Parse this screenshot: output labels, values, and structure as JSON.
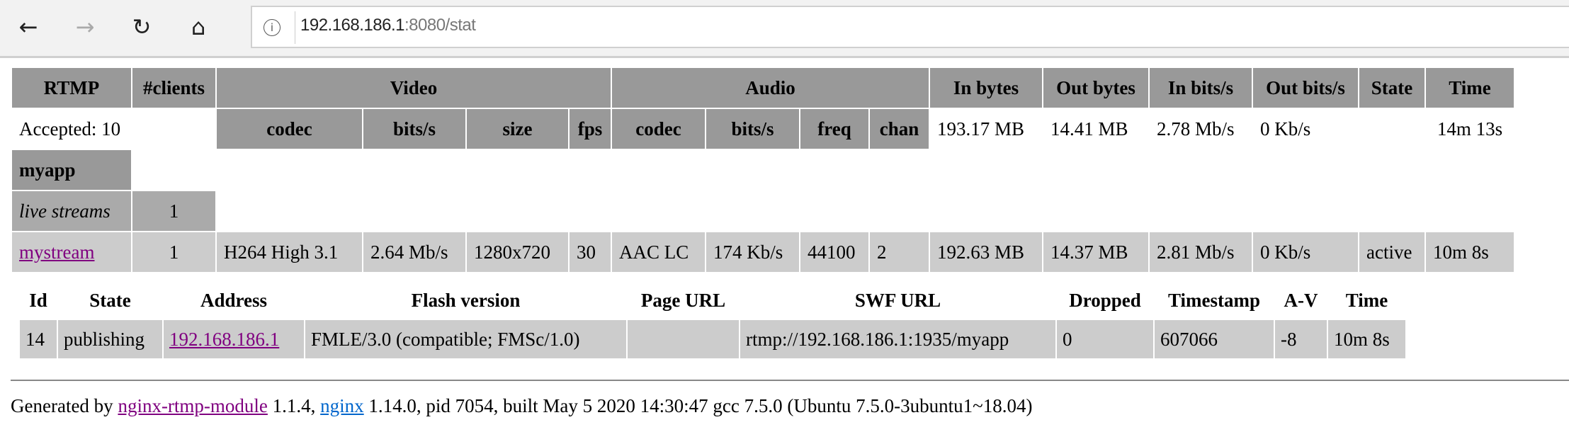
{
  "browser": {
    "url_host": "192.168.186.1",
    "url_rest": ":8080/stat",
    "icons": [
      "back-arrow-icon",
      "forward-arrow-icon",
      "refresh-icon",
      "home-icon",
      "info-icon"
    ]
  },
  "main_table": {
    "headers": {
      "rtmp": "RTMP",
      "clients": "#clients",
      "video": "Video",
      "audio": "Audio",
      "in_bytes": "In bytes",
      "out_bytes": "Out bytes",
      "in_bits": "In bits/s",
      "out_bits": "Out bits/s",
      "state": "State",
      "time": "Time"
    },
    "subheaders": {
      "v_codec": "codec",
      "v_bits": "bits/s",
      "v_size": "size",
      "v_fps": "fps",
      "a_codec": "codec",
      "a_bits": "bits/s",
      "a_freq": "freq",
      "a_chan": "chan"
    },
    "server": {
      "accepted": "Accepted: 10",
      "in_bytes": "193.17 MB",
      "out_bytes": "14.41 MB",
      "in_bits": "2.78 Mb/s",
      "out_bits": "0 Kb/s",
      "time": "14m 13s"
    },
    "app": {
      "name": "myapp",
      "live_label": "live streams",
      "live_count": "1"
    },
    "stream": {
      "name": "mystream",
      "clients": "1",
      "v_codec": "H264 High 3.1",
      "v_bits": "2.64 Mb/s",
      "v_size": "1280x720",
      "v_fps": "30",
      "a_codec": "AAC LC",
      "a_bits": "174 Kb/s",
      "a_freq": "44100",
      "a_chan": "2",
      "in_bytes": "192.63 MB",
      "out_bytes": "14.37 MB",
      "in_bits": "2.81 Mb/s",
      "out_bits": "0 Kb/s",
      "state": "active",
      "time": "10m 8s"
    }
  },
  "client_table": {
    "headers": [
      "Id",
      "State",
      "Address",
      "Flash version",
      "Page URL",
      "SWF URL",
      "Dropped",
      "Timestamp",
      "A-V",
      "Time"
    ],
    "row": {
      "id": "14",
      "state": "publishing",
      "address": "192.168.186.1",
      "flash": "FMLE/3.0 (compatible; FMSc/1.0)",
      "page_url": "",
      "swf_url": "rtmp://192.168.186.1:1935/myapp",
      "dropped": "0",
      "timestamp": "607066",
      "av": "-8",
      "time": "10m 8s"
    }
  },
  "footer": {
    "prefix": "Generated by ",
    "module_link": "nginx-rtmp-module",
    "mid": " 1.1.4, ",
    "nginx_link": "nginx",
    "suffix": " 1.14.0, pid 7054, built May 5 2020 14:30:47 gcc 7.5.0 (Ubuntu 7.5.0-3ubuntu1~18.04)"
  }
}
